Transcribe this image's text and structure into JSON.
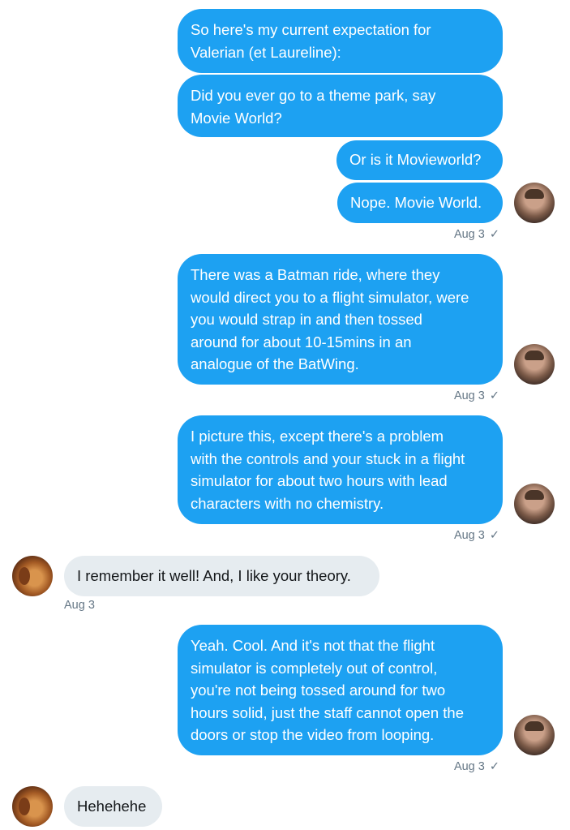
{
  "messages": [
    {
      "lines": [
        "So here's my current expectation for",
        "Valerian (et Laureline):"
      ]
    },
    {
      "lines": [
        "Did you ever go to a theme park, say",
        "Movie World?"
      ]
    },
    {
      "lines": [
        "Or is it Movieworld?"
      ]
    },
    {
      "lines": [
        "Nope. Movie World."
      ]
    },
    {
      "lines": [
        "There was a Batman ride, where they",
        "would direct you to a flight simulator, were",
        "you would strap in and then tossed",
        "around for about 10-15mins in an",
        "analogue of the BatWing."
      ]
    },
    {
      "lines": [
        "I picture this, except there's a problem",
        "with the controls and your stuck in a flight",
        "simulator for about two hours with lead",
        "characters with no chemistry."
      ]
    },
    {
      "lines": [
        "I remember it well! And, I like your theory."
      ]
    },
    {
      "lines": [
        "Yeah. Cool. And it's not that the flight",
        "simulator is completely out of control,",
        "you're not being tossed around for two",
        "hours solid, just the staff cannot open the",
        "doors or stop the video from looping."
      ]
    },
    {
      "lines": [
        "Hehehehe"
      ]
    }
  ],
  "timestamps": {
    "t1": "Aug 3",
    "t2": "Aug 3",
    "t3": "Aug 3",
    "t4": "Aug 3",
    "t5": "Aug 3"
  },
  "read_check": "✓",
  "colors": {
    "sent_bubble": "#1da1f2",
    "received_bubble": "#e6ecf0",
    "timestamp_text": "#657786"
  }
}
